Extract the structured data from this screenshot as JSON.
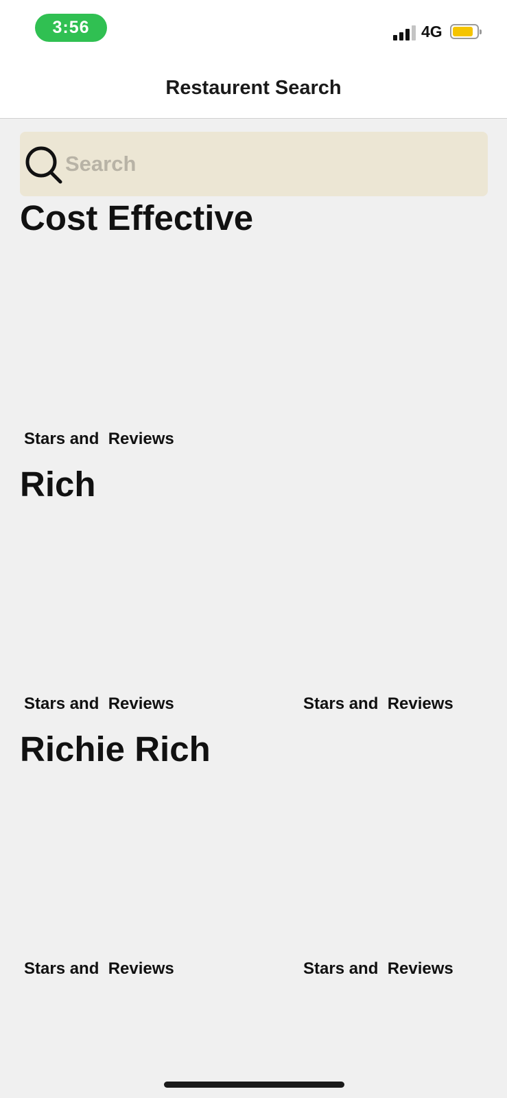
{
  "status_bar": {
    "time": "3:56",
    "network": "4G",
    "battery_level": 0.85
  },
  "nav": {
    "title": "Restaurent Search"
  },
  "search": {
    "placeholder": "Search",
    "value": ""
  },
  "sections": [
    {
      "title": "Cost Effective",
      "cards": [
        {
          "label": "Stars and  Reviews"
        }
      ]
    },
    {
      "title": "Rich",
      "cards": [
        {
          "label": "Stars and  Reviews"
        },
        {
          "label": "Stars and  Reviews"
        }
      ]
    },
    {
      "title": "Richie Rich",
      "cards": [
        {
          "label": "Stars and  Reviews"
        },
        {
          "label": "Stars and  Reviews"
        }
      ]
    }
  ],
  "colors": {
    "time_pill": "#30c052",
    "search_bg": "#ece6d4",
    "battery": "#f5c400",
    "page_bg": "#f0f0f0"
  }
}
